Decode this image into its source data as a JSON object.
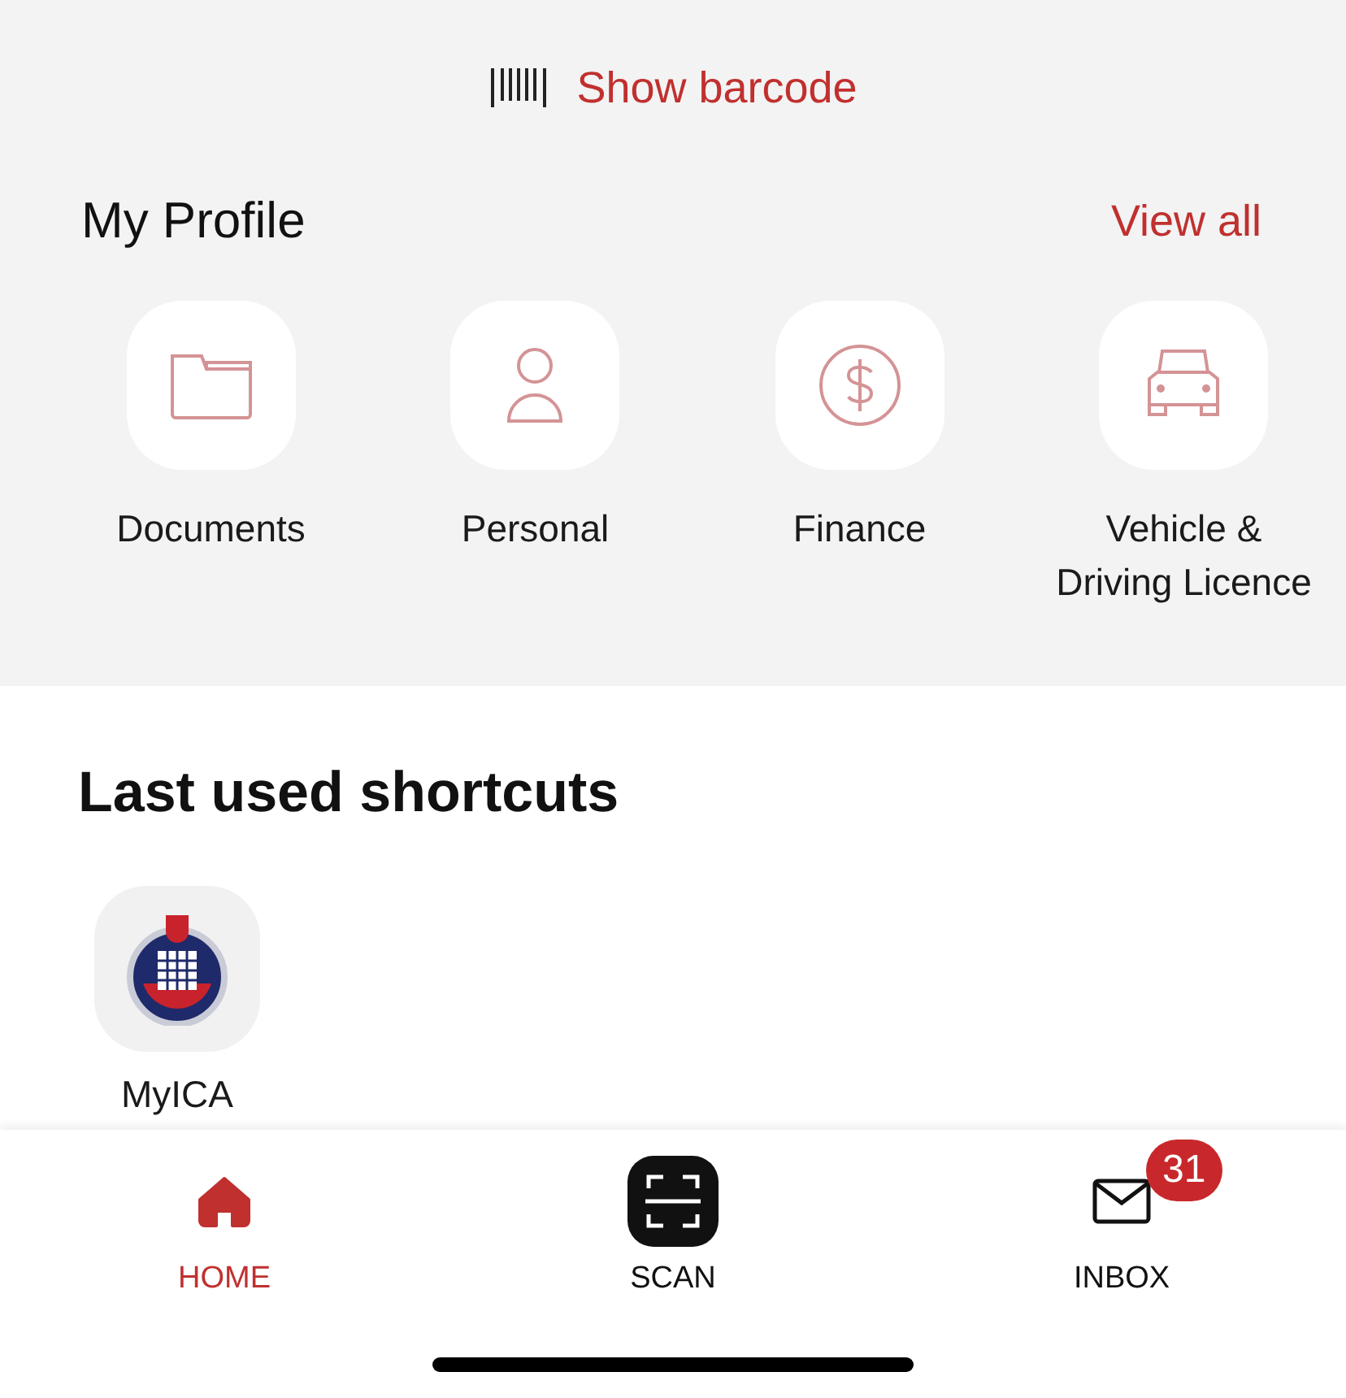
{
  "barcode_button": {
    "label": "Show barcode"
  },
  "profile": {
    "title": "My Profile",
    "view_all": "View all",
    "items": [
      {
        "kind": "folder",
        "label": "Documents"
      },
      {
        "kind": "person",
        "label": "Personal"
      },
      {
        "kind": "dollar",
        "label": "Finance"
      },
      {
        "kind": "car",
        "label": "Vehicle & Driving Licence"
      }
    ]
  },
  "shortcuts": {
    "title": "Last used shortcuts",
    "items": [
      {
        "kind": "emblem",
        "label": "MyICA"
      }
    ]
  },
  "tab_bar": [
    {
      "kind": "home",
      "label": "HOME",
      "selected": true
    },
    {
      "kind": "scan",
      "label": "SCAN",
      "selected": false
    },
    {
      "kind": "inbox",
      "label": "INBOX",
      "selected": false,
      "badge": "31"
    }
  ]
}
